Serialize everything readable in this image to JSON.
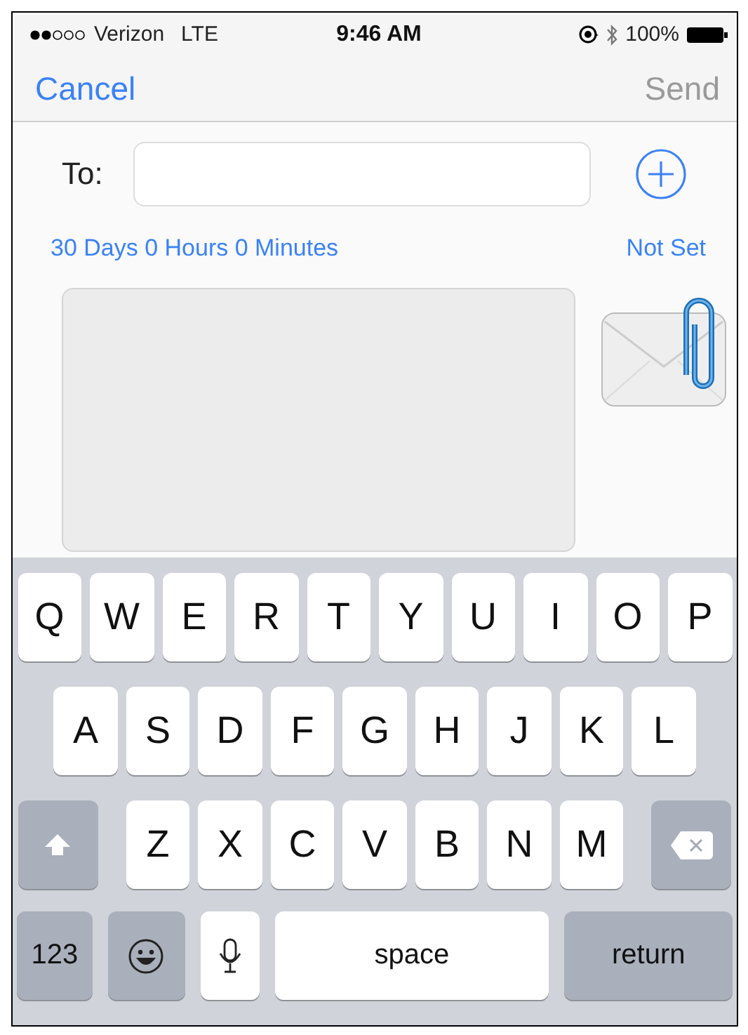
{
  "status_bar": {
    "carrier": "Verizon",
    "network": "LTE",
    "time": "9:46 AM",
    "battery": "100%"
  },
  "nav": {
    "cancel": "Cancel",
    "send": {
      "label": "Send",
      "disabled": true
    }
  },
  "to": {
    "label": "To:"
  },
  "expiry": "30 Days 0 Hours 0 Minutes",
  "schedule": "Not Set",
  "keyboard": {
    "rows": [
      {
        "keys": [
          {
            "kind": "letter",
            "label": "Q"
          },
          {
            "kind": "letter",
            "label": "W"
          },
          {
            "kind": "letter",
            "label": "E"
          },
          {
            "kind": "letter",
            "label": "R"
          },
          {
            "kind": "letter",
            "label": "T"
          },
          {
            "kind": "letter",
            "label": "Y"
          },
          {
            "kind": "letter",
            "label": "U"
          },
          {
            "kind": "letter",
            "label": "I"
          },
          {
            "kind": "letter",
            "label": "O"
          },
          {
            "kind": "letter",
            "label": "P"
          }
        ]
      },
      {
        "keys": [
          {
            "kind": "letter",
            "label": "A"
          },
          {
            "kind": "letter",
            "label": "S"
          },
          {
            "kind": "letter",
            "label": "D"
          },
          {
            "kind": "letter",
            "label": "F"
          },
          {
            "kind": "letter",
            "label": "G"
          },
          {
            "kind": "letter",
            "label": "H"
          },
          {
            "kind": "letter",
            "label": "J"
          },
          {
            "kind": "letter",
            "label": "K"
          },
          {
            "kind": "letter",
            "label": "L"
          }
        ]
      },
      {
        "keys": [
          {
            "kind": "shift"
          },
          {
            "kind": "letter",
            "label": "Z"
          },
          {
            "kind": "letter",
            "label": "X"
          },
          {
            "kind": "letter",
            "label": "C"
          },
          {
            "kind": "letter",
            "label": "V"
          },
          {
            "kind": "letter",
            "label": "B"
          },
          {
            "kind": "letter",
            "label": "N"
          },
          {
            "kind": "letter",
            "label": "M"
          },
          {
            "kind": "delete"
          }
        ]
      },
      {
        "keys": [
          {
            "kind": "numbers",
            "label": "123"
          },
          {
            "kind": "emoji"
          },
          {
            "kind": "mic"
          },
          {
            "kind": "space",
            "label": "space"
          },
          {
            "kind": "return",
            "label": "return"
          }
        ]
      }
    ]
  }
}
